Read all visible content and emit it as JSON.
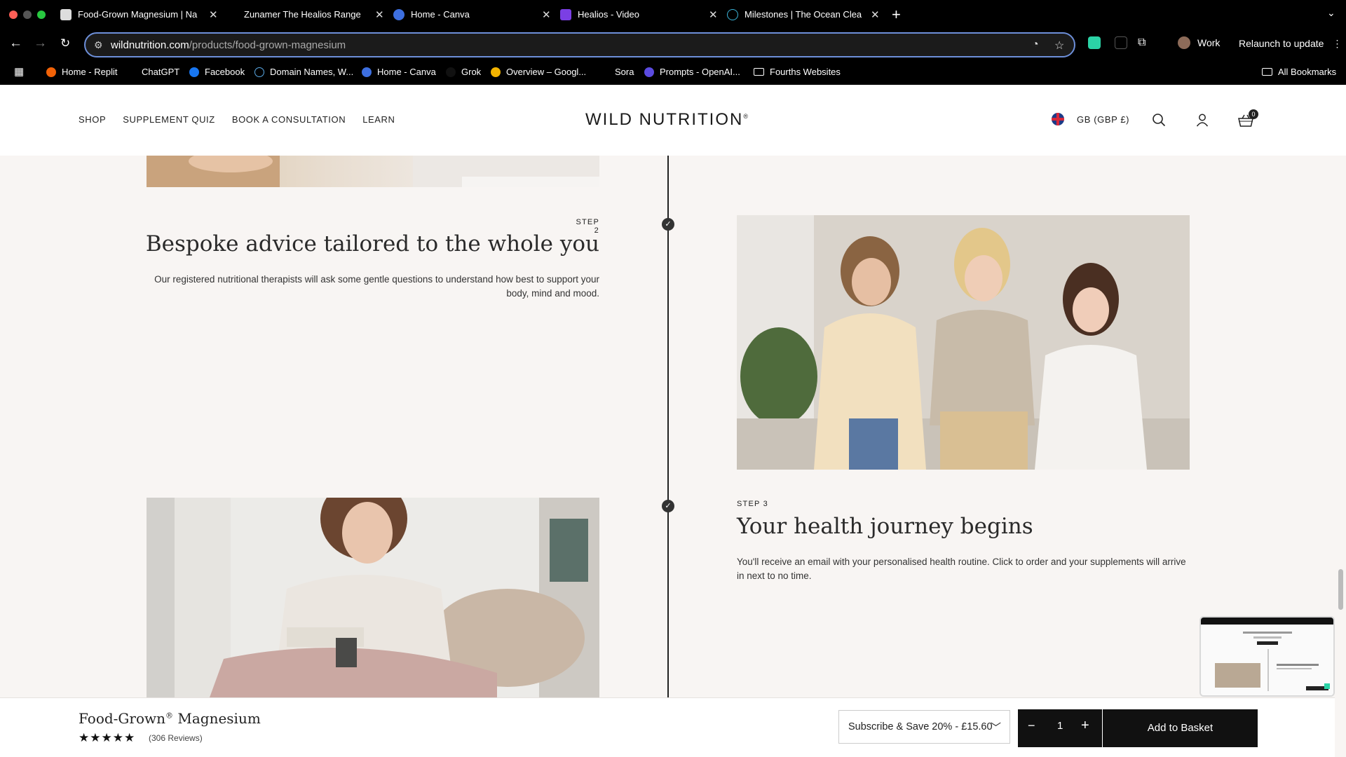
{
  "browser": {
    "tabs": [
      {
        "title": "Food-Grown Magnesium | Na",
        "active": true
      },
      {
        "title": "Zunamer The Healios Range",
        "active": false
      },
      {
        "title": "Home - Canva",
        "active": false
      },
      {
        "title": "Healios - Video",
        "active": false
      },
      {
        "title": "Milestones | The Ocean Clean",
        "active": false
      }
    ],
    "url_domain": "wildnutrition.com",
    "url_path": "/products/food-grown-magnesium",
    "profile_name": "Work",
    "relaunch_label": "Relaunch to update",
    "bookmarks": [
      "Home - Replit",
      "ChatGPT",
      "Facebook",
      "Domain Names, W...",
      "Home - Canva",
      "Grok",
      "Overview – Googl...",
      "Sora",
      "Prompts - OpenAI...",
      "Fourths Websites"
    ],
    "all_bookmarks_label": "All Bookmarks"
  },
  "site": {
    "nav": [
      "SHOP",
      "SUPPLEMENT QUIZ",
      "BOOK A CONSULTATION",
      "LEARN"
    ],
    "logo": "WILD NUTRITION",
    "logo_mark": "®",
    "locale": "GB (GBP £)",
    "cart_count": "0"
  },
  "steps": [
    {
      "label": "STEP 2",
      "title": "Bespoke advice tailored to the whole you",
      "body": "Our registered nutritional therapists will ask some gentle questions to understand how best to support your body, mind and mood."
    },
    {
      "label": "STEP 3",
      "title": "Your health journey begins",
      "body": "You'll receive an email with your personalised health routine. Click to order and your supplements will arrive in next to no time."
    }
  ],
  "product_bar": {
    "name": "Food-Grown",
    "name_mark": "®",
    "name_suffix": " Magnesium",
    "stars": "★★★★★",
    "reviews": "(306 Reviews)",
    "subscribe_option": "Subscribe & Save 20% - £15.60",
    "quantity": "1",
    "add_label": "Add to Basket"
  },
  "icons": {
    "search": "search-icon",
    "account": "account-icon",
    "cart": "basket-icon"
  }
}
